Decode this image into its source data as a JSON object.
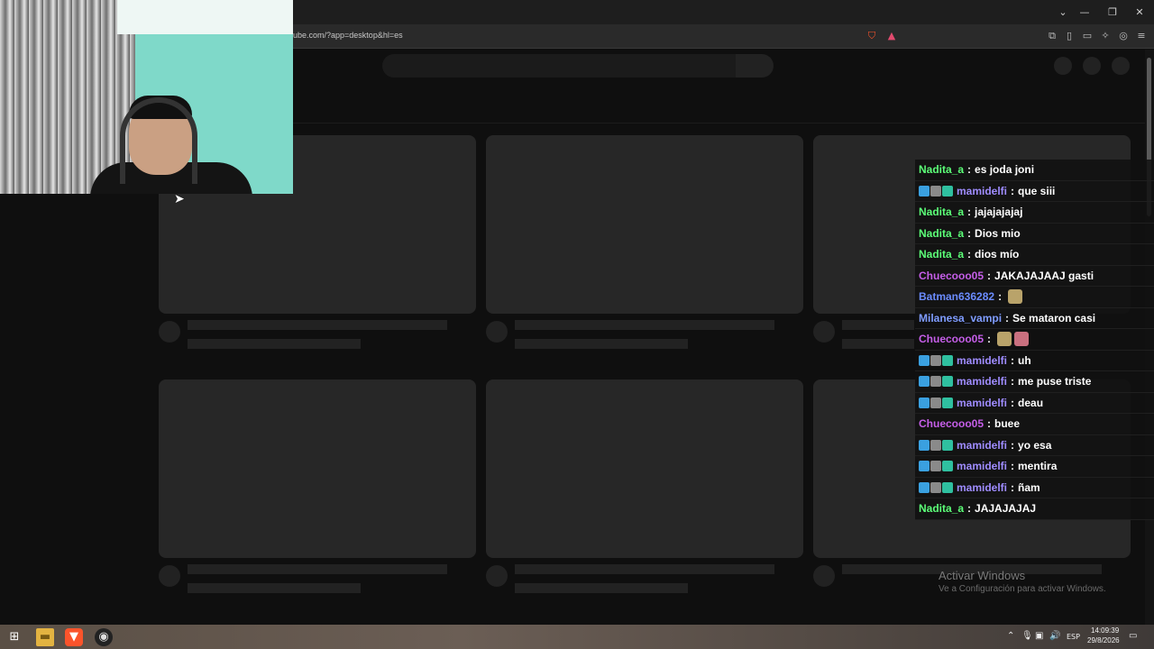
{
  "browser": {
    "url": "ube.com/?app=desktop&hl=es",
    "window_controls": [
      "⌄",
      "—",
      "❐",
      "✕"
    ],
    "toolbar_icons": [
      "extensions-icon",
      "sidebar-icon",
      "wallet-icon",
      "leo-icon",
      "vpn-icon",
      "menu-icon"
    ]
  },
  "chat": {
    "colors": {
      "Nadita_a": "#5cff78",
      "mamidelfi": "#9f8cff",
      "Chuecooo05": "#c55ee8",
      "Batman636282": "#6b8cff",
      "Milanesa_vampi": "#7f9cff"
    },
    "messages": [
      {
        "user": "Nadita_a",
        "sep": ":",
        "text": "es joda joni",
        "badges": false,
        "emotes": 0
      },
      {
        "user": "mamidelfi",
        "sep": ":",
        "text": "que siii",
        "badges": true,
        "emotes": 0
      },
      {
        "user": "Nadita_a",
        "sep": ":",
        "text": "jajajajajaj",
        "badges": false,
        "emotes": 0
      },
      {
        "user": "Nadita_a",
        "sep": ":",
        "text": "Dios mio",
        "badges": false,
        "emotes": 0
      },
      {
        "user": "Nadita_a",
        "sep": ":",
        "text": "dios mío",
        "badges": false,
        "emotes": 0
      },
      {
        "user": "Chuecooo05",
        "sep": ":",
        "text": "JAKAJAJAAJ gasti",
        "badges": false,
        "emotes": 0
      },
      {
        "user": "Batman636282",
        "sep": ":",
        "text": "",
        "badges": false,
        "emotes": 1
      },
      {
        "user": "Milanesa_vampi",
        "sep": ":",
        "text": "Se mataron casi",
        "badges": false,
        "emotes": 0
      },
      {
        "user": "Chuecooo05",
        "sep": ":",
        "text": "",
        "badges": false,
        "emotes": 2
      },
      {
        "user": "mamidelfi",
        "sep": ":",
        "text": "uh",
        "badges": true,
        "emotes": 0
      },
      {
        "user": "mamidelfi",
        "sep": ":",
        "text": "me puse triste",
        "badges": true,
        "emotes": 0
      },
      {
        "user": "mamidelfi",
        "sep": ":",
        "text": "deau",
        "badges": true,
        "emotes": 0
      },
      {
        "user": "Chuecooo05",
        "sep": ":",
        "text": "buee",
        "badges": false,
        "emotes": 0
      },
      {
        "user": "mamidelfi",
        "sep": ":",
        "text": "yo esa",
        "badges": true,
        "emotes": 0
      },
      {
        "user": "mamidelfi",
        "sep": ":",
        "text": "mentira",
        "badges": true,
        "emotes": 0
      },
      {
        "user": "mamidelfi",
        "sep": ":",
        "text": "ñam",
        "badges": true,
        "emotes": 0
      },
      {
        "user": "Nadita_a",
        "sep": ":",
        "text": "JAJAJAJAJ",
        "badges": false,
        "emotes": 0
      }
    ]
  },
  "watermark": {
    "title": "Activar Windows",
    "subtitle": "Ve a Configuración para activar Windows."
  },
  "taskbar": {
    "language": "ESP",
    "time": "14:09:39",
    "date": "29/8/2026"
  }
}
